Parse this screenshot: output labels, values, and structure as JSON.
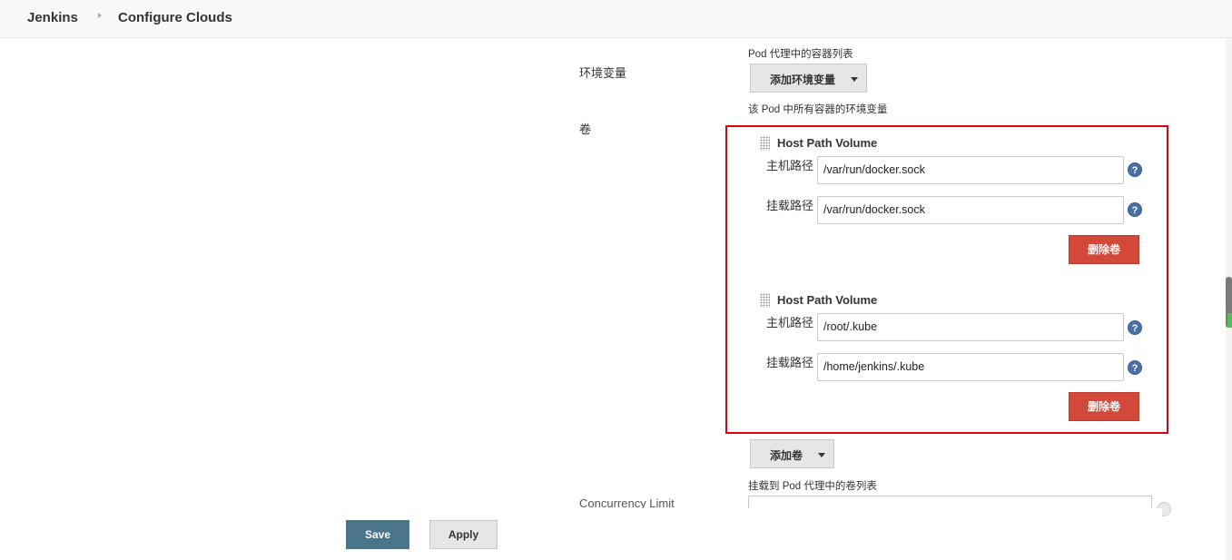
{
  "breadcrumb": {
    "home": "Jenkins",
    "current": "Configure Clouds"
  },
  "form": {
    "container_list_hint": "Pod 代理中的容器列表",
    "env_label": "环境变量",
    "add_env_button": "添加环境变量",
    "env_hint": "该 Pod 中所有容器的环境变量",
    "volumes_label": "卷",
    "volumes": [
      {
        "title": "Host Path Volume",
        "host_path_label": "主机路径",
        "host_path_value": "/var/run/docker.sock",
        "mount_path_label": "挂载路径",
        "mount_path_value": "/var/run/docker.sock",
        "delete_button": "删除卷"
      },
      {
        "title": "Host Path Volume",
        "host_path_label": "主机路径",
        "host_path_value": "/root/.kube",
        "mount_path_label": "挂载路径",
        "mount_path_value": "/home/jenkins/.kube",
        "delete_button": "删除卷"
      }
    ],
    "add_volume_button": "添加卷",
    "volumes_hint": "挂载到 Pod 代理中的卷列表",
    "concurrency_label": "Concurrency Limit",
    "help_glyph": "?"
  },
  "actions": {
    "save": "Save",
    "apply": "Apply"
  },
  "colors": {
    "highlight_border": "#e1000f",
    "delete_button": "#d24939",
    "save_button": "#4b758b"
  }
}
